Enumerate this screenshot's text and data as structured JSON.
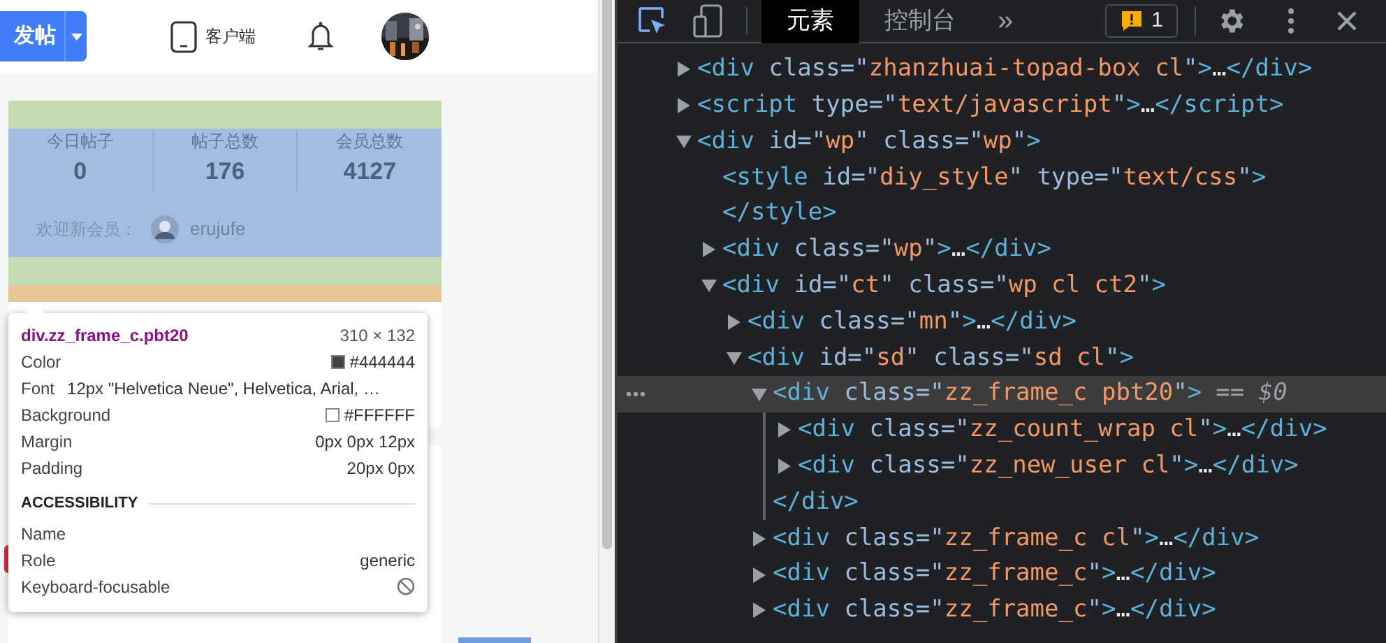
{
  "page": {
    "post_button": "发帖",
    "client_link": "客户端",
    "stats": [
      {
        "label": "今日帖子",
        "value": "0"
      },
      {
        "label": "帖子总数",
        "value": "176"
      },
      {
        "label": "会员总数",
        "value": "4127"
      }
    ],
    "new_member_label": "欢迎新会员：",
    "new_member": "erujufe"
  },
  "inspector_tooltip": {
    "selector": "div.zz_frame_c.pbt20",
    "size": "310 × 132",
    "rows": [
      {
        "kind": "swatch",
        "label": "Color",
        "value": "#444444",
        "color": "#444444"
      },
      {
        "kind": "inline",
        "label": "Font",
        "value": "12px \"Helvetica Neue\", Helvetica, Arial, …"
      },
      {
        "kind": "swatch",
        "label": "Background",
        "value": "#FFFFFF",
        "color": "#ffffff"
      },
      {
        "kind": "text",
        "label": "Margin",
        "value": "0px 0px 12px"
      },
      {
        "kind": "text",
        "label": "Padding",
        "value": "20px 0px"
      }
    ],
    "section": "ACCESSIBILITY",
    "a11y_rows": [
      {
        "kind": "text",
        "label": "Name"
      },
      {
        "kind": "text",
        "label": "Role",
        "value": "generic"
      },
      {
        "kind": "blocked",
        "label": "Keyboard-focusable"
      }
    ]
  },
  "devtools": {
    "tabs": [
      {
        "label": "元素",
        "selected": true
      },
      {
        "label": "控制台",
        "selected": false
      }
    ],
    "more": "»",
    "issues": "1",
    "tree": [
      {
        "text": "<div class=\"zhanzhuai-topad-box cl\">…</div>",
        "expandable": true,
        "expanded": false
      },
      {
        "text": "<script type=\"text/javascript\">…</script>",
        "expandable": true,
        "expanded": false
      },
      {
        "text": "<div id=\"wp\" class=\"wp\">",
        "expandable": true,
        "expanded": true,
        "children": [
          {
            "text": "<style id=\"diy_style\" type=\"text/css\">",
            "expandable": false,
            "closing": "</style>"
          },
          {
            "text": "<div class=\"wp\">…</div>",
            "expandable": true,
            "expanded": false
          },
          {
            "text": "<div id=\"ct\" class=\"wp cl ct2\">",
            "expandable": true,
            "expanded": true,
            "children": [
              {
                "text": "<div class=\"mn\">…</div>",
                "expandable": true,
                "expanded": false
              },
              {
                "text": "<div id=\"sd\" class=\"sd cl\">",
                "expandable": true,
                "expanded": true,
                "children": [
                  {
                    "text": "<div class=\"zz_frame_c pbt20\">",
                    "expandable": true,
                    "expanded": true,
                    "selected": true,
                    "marker": "== $0",
                    "closing": "</div>",
                    "children": [
                      {
                        "text": "<div class=\"zz_count_wrap cl\">…</div>",
                        "expandable": true,
                        "expanded": false
                      },
                      {
                        "text": "<div class=\"zz_new_user cl\">…</div>",
                        "expandable": true,
                        "expanded": false
                      }
                    ]
                  },
                  {
                    "text": "<div class=\"zz_frame_c cl\">…</div>",
                    "expandable": true,
                    "expanded": false,
                    "selected": false
                  },
                  {
                    "text": "<div class=\"zz_frame_c\">…</div>",
                    "expandable": true,
                    "expanded": false,
                    "selected": false
                  },
                  {
                    "text": "<div class=\"zz_frame_c\">…</div>",
                    "expandable": true,
                    "expanded": false,
                    "selected": false
                  }
                ]
              }
            ]
          }
        ]
      }
    ]
  }
}
